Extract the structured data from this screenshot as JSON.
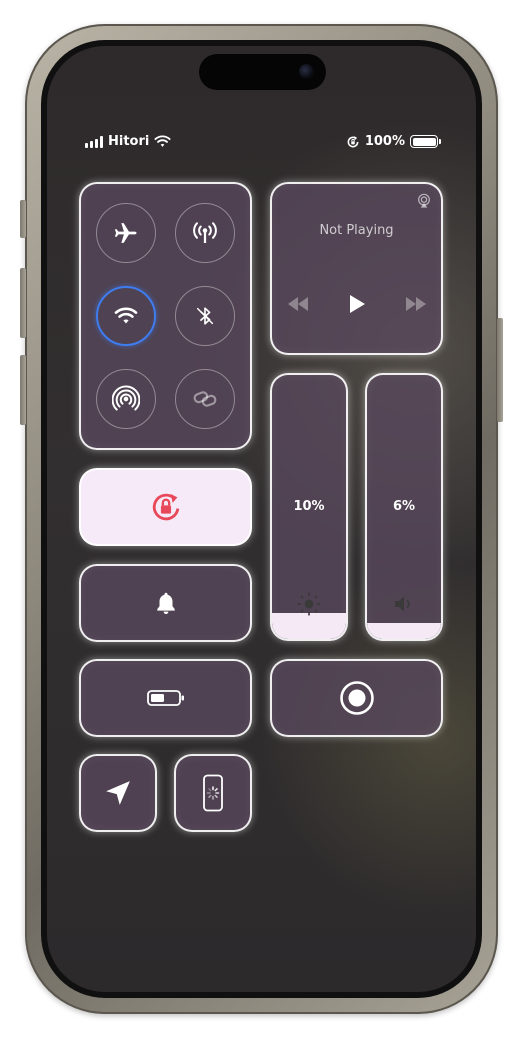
{
  "status_bar": {
    "carrier": "Hitori",
    "battery_percent_label": "100%",
    "icons": [
      "signal-bars-icon",
      "wifi-icon",
      "rotation-lock-icon",
      "battery-icon"
    ]
  },
  "connectivity": {
    "buttons": [
      {
        "name": "airplane-mode",
        "icon": "airplane-icon",
        "active": false
      },
      {
        "name": "cellular-data",
        "icon": "antenna-icon",
        "active": false
      },
      {
        "name": "wifi",
        "icon": "wifi-icon",
        "active": true
      },
      {
        "name": "bluetooth",
        "icon": "bluetooth-icon",
        "active": false
      },
      {
        "name": "airdrop",
        "icon": "airdrop-icon",
        "active": false
      },
      {
        "name": "personal-hotspot",
        "icon": "link-icon",
        "active": false
      }
    ]
  },
  "media": {
    "title": "Not Playing",
    "icons": [
      "airplay-audio-icon",
      "rewind-icon",
      "play-icon",
      "fast-forward-icon"
    ]
  },
  "brightness": {
    "label": "10%",
    "level": 0.1,
    "icon": "sun-icon"
  },
  "volume": {
    "label": "6%",
    "level": 0.06,
    "icon": "speaker-icon"
  },
  "tiles": {
    "rotation_lock": {
      "icon": "rotation-lock-icon",
      "active": true
    },
    "silent_mode": {
      "icon": "bell-icon"
    },
    "low_power_mode": {
      "icon": "battery-icon"
    },
    "screen_record": {
      "icon": "record-icon"
    },
    "location": {
      "icon": "location-arrow-icon"
    },
    "screen_mirroring": {
      "icon": "phone-loading-icon"
    }
  },
  "colors": {
    "tile_bg": "#58485C",
    "active_tile_bg": "#F7EAF8",
    "rotation_lock_accent": "#E8495A",
    "wifi_active_ring": "#3F7CF0"
  }
}
